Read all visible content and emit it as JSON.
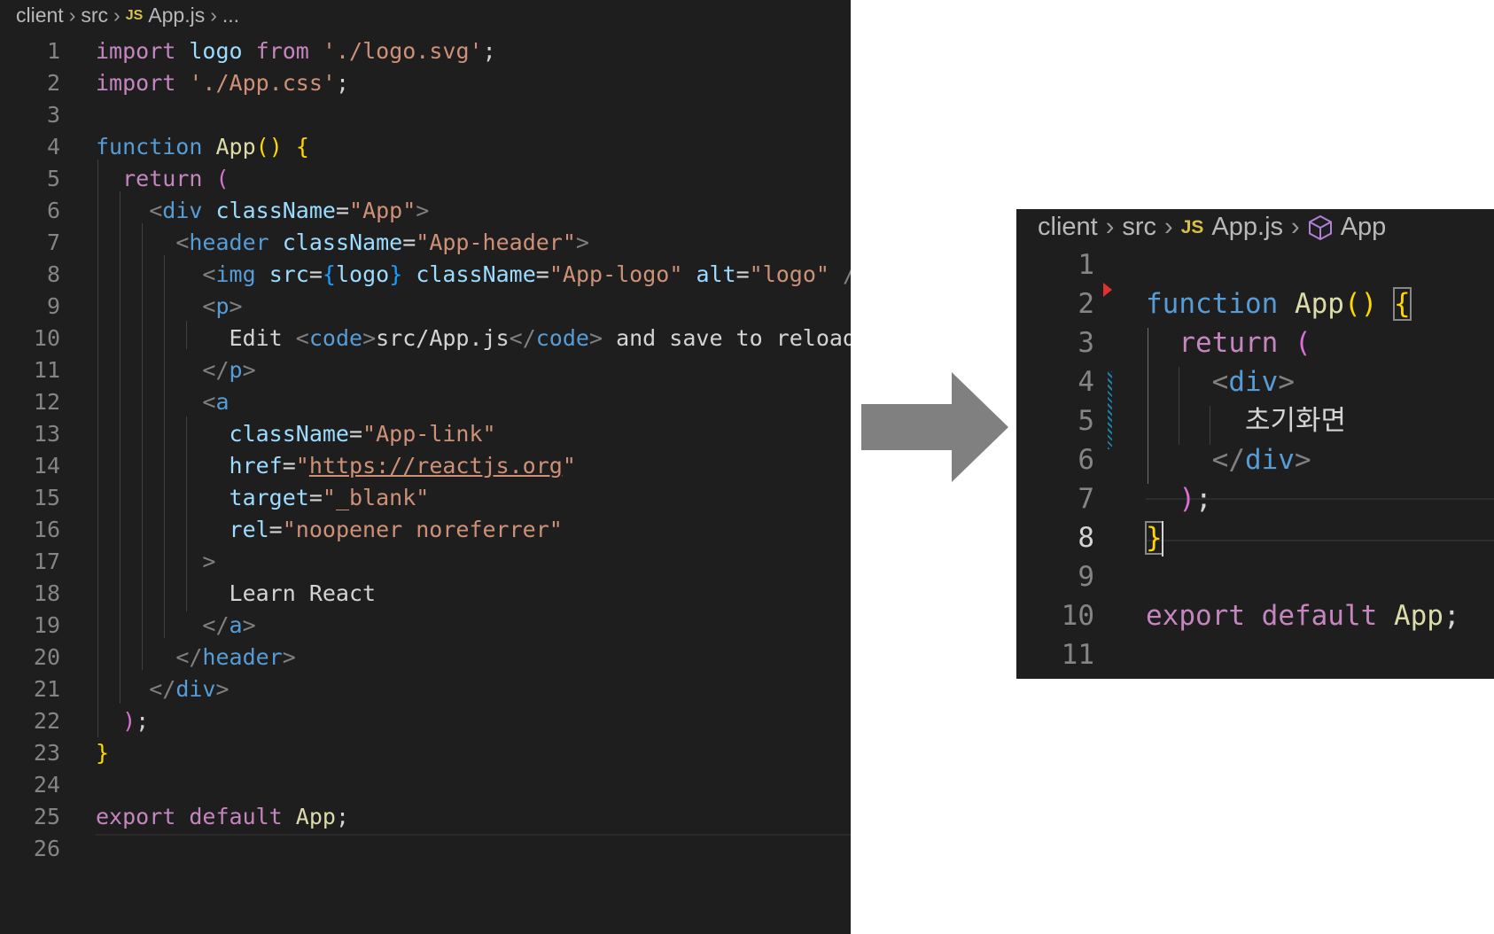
{
  "left_editor": {
    "breadcrumb": {
      "folder1": "client",
      "folder2": "src",
      "file_icon": "JS",
      "file": "App.js",
      "symbol": "..."
    },
    "line_numbers": [
      "1",
      "2",
      "3",
      "4",
      "5",
      "6",
      "7",
      "8",
      "9",
      "10",
      "11",
      "12",
      "13",
      "14",
      "15",
      "16",
      "17",
      "18",
      "19",
      "20",
      "21",
      "22",
      "23",
      "24",
      "25",
      "26"
    ]
  },
  "right_editor": {
    "breadcrumb": {
      "folder1": "client",
      "folder2": "src",
      "file_icon": "JS",
      "file": "App.js",
      "symbol_icon": "cube-icon",
      "symbol": "App"
    },
    "line_numbers": [
      "1",
      "2",
      "3",
      "4",
      "5",
      "6",
      "7",
      "8",
      "9",
      "10",
      "11"
    ],
    "content_text": "초기화면"
  },
  "transition_icon": "arrow-right-icon",
  "colors": {
    "editor_background": "#1e1e1e",
    "keyword": "#c586c0",
    "keyword_blue": "#569cd6",
    "function_name": "#dcdcaa",
    "string": "#ce9178",
    "attribute": "#9cdcfe",
    "arrow": "#808080"
  }
}
